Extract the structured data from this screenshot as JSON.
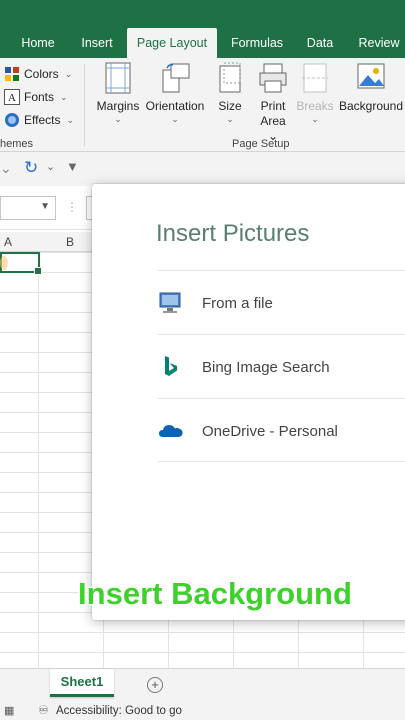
{
  "ribbon_tabs": [
    "Home",
    "Insert",
    "Page Layout",
    "Formulas",
    "Data",
    "Review"
  ],
  "active_tab": "Page Layout",
  "themes": {
    "colors_label": "Colors",
    "fonts_label": "Fonts",
    "effects_label": "Effects",
    "group_label": "hemes"
  },
  "page_setup": {
    "margins": "Margins",
    "orientation": "Orientation",
    "size": "Size",
    "print_area": "Print Area",
    "print_area_line1": "Print",
    "print_area_line2": "Area",
    "breaks": "Breaks",
    "background": "Background",
    "group_label": "Page Setup"
  },
  "grid": {
    "columns": [
      "A",
      "B"
    ]
  },
  "dialog": {
    "title": "Insert Pictures",
    "options": [
      {
        "label": "From a file",
        "icon": "computer-icon"
      },
      {
        "label": "Bing Image Search",
        "icon": "bing-logo-icon"
      },
      {
        "label": "OneDrive - Personal",
        "icon": "onedrive-cloud-icon"
      }
    ]
  },
  "sheet_tab": "Sheet1",
  "status": {
    "accessibility": "Accessibility: Good to go"
  },
  "caption": "Insert Background",
  "colors": {
    "excel_green": "#1e7145",
    "caption_green": "#3dd12b",
    "dialog_title": "#5a7d74",
    "bing_teal": "#008373",
    "onedrive_blue": "#0a63b6"
  }
}
